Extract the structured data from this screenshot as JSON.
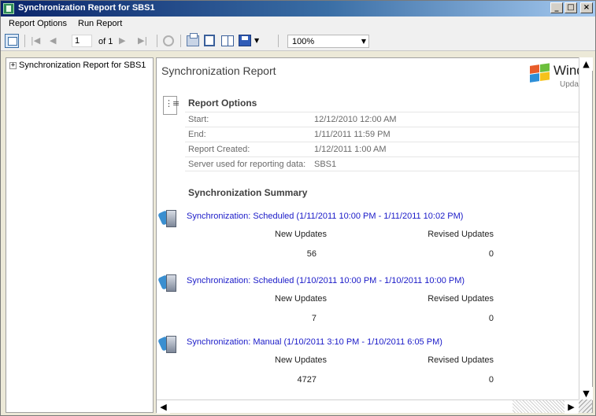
{
  "window": {
    "title": "Synchronization Report for SBS1",
    "controls": {
      "minimize": "_",
      "maximize": "□",
      "close": "×"
    }
  },
  "menu": {
    "items": [
      {
        "label": "Report Options"
      },
      {
        "label": "Run Report"
      }
    ]
  },
  "toolbar": {
    "page_current": "1",
    "page_total_text": "of 1",
    "zoom": "100%",
    "icons": [
      "document-map-icon",
      "first-page-icon",
      "previous-page-icon",
      "next-page-icon",
      "last-page-icon",
      "stop-icon",
      "print-icon",
      "print-layout-icon",
      "page-setup-icon",
      "export-icon"
    ]
  },
  "doc_map": {
    "expander": "+",
    "root_label": "Synchronization Report for SBS1"
  },
  "report": {
    "title": "Synchronization Report",
    "logo": {
      "text": "Wind",
      "subtext": "Update"
    },
    "report_options": {
      "heading": "Report Options",
      "rows": [
        {
          "label": "Start:",
          "value": "12/12/2010 12:00 AM"
        },
        {
          "label": "End:",
          "value": "1/11/2011 11:59 PM"
        },
        {
          "label": "Report Created:",
          "value": "1/12/2011 1:00 AM"
        },
        {
          "label": "Server used for reporting data:",
          "value": "SBS1"
        }
      ]
    },
    "summary": {
      "heading": "Synchronization Summary",
      "column_new": "New Updates",
      "column_revised": "Revised Updates",
      "entries": [
        {
          "title": "Synchronization: Scheduled (1/11/2011 10:00 PM - 1/11/2011 10:02 PM)",
          "new_updates": "56",
          "revised_updates": "0"
        },
        {
          "title": "Synchronization: Scheduled (1/10/2011 10:00 PM - 1/10/2011 10:00 PM)",
          "new_updates": "7",
          "revised_updates": "0"
        },
        {
          "title": "Synchronization: Manual (1/10/2011 3:10 PM - 1/10/2011 6:05 PM)",
          "new_updates": "4727",
          "revised_updates": "0"
        }
      ]
    }
  },
  "colors": {
    "link": "#1a1ac8",
    "titlebar_start": "#0a246a",
    "titlebar_end": "#a6caf0"
  }
}
